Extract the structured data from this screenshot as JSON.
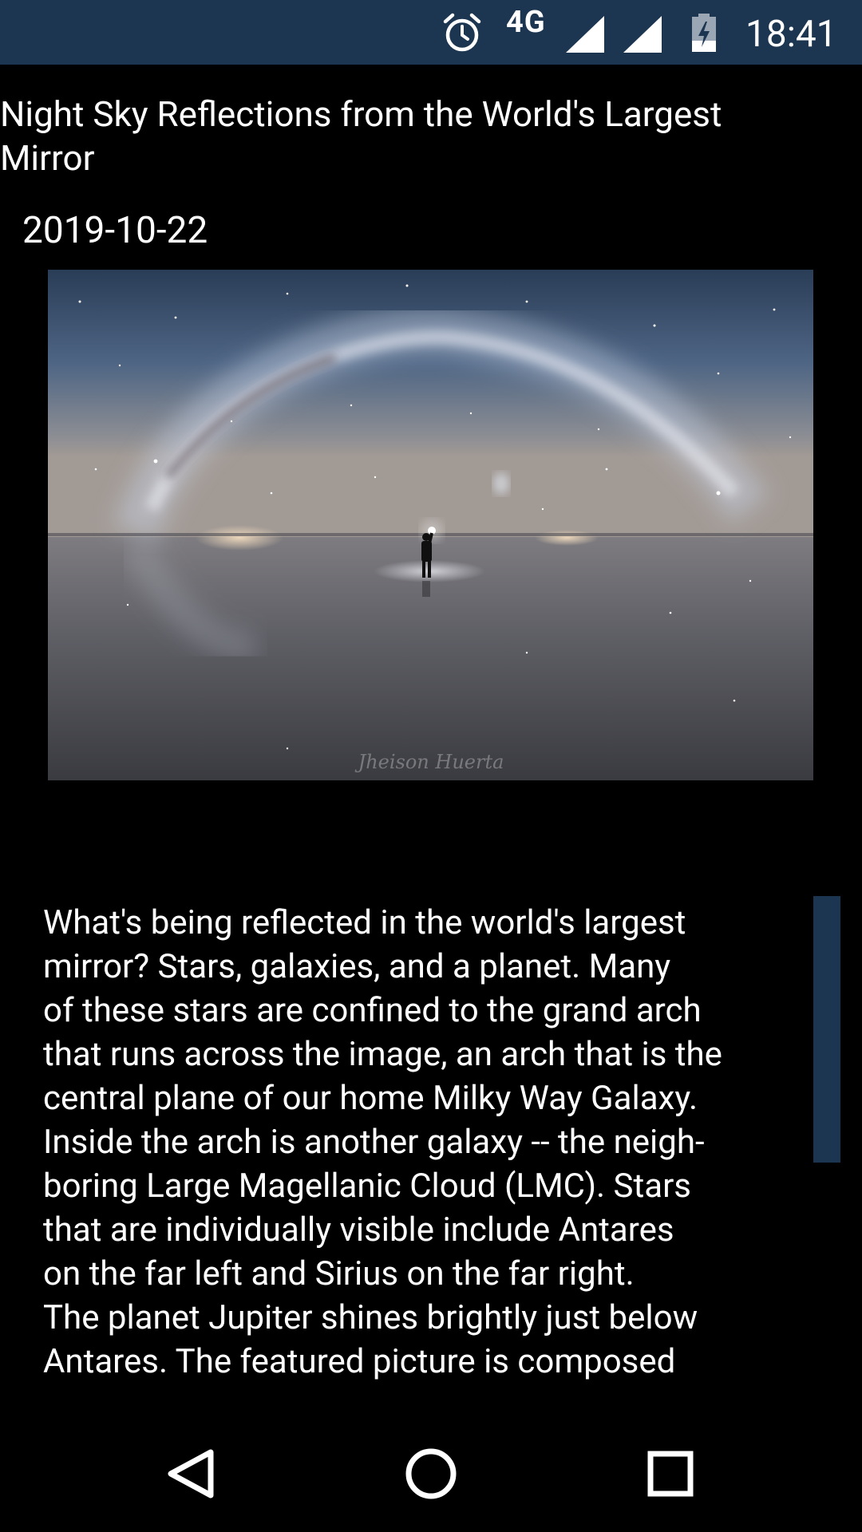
{
  "status_bar": {
    "network": "4G",
    "time": "18:41",
    "icons": [
      "alarm-icon",
      "signal-icon",
      "signal-icon",
      "battery-charging-icon"
    ]
  },
  "article": {
    "title": "Night Sky Reflections from the World's Largest Mirror",
    "date": "2019-10-22",
    "image": {
      "subject": "Milky Way arch reflected over salt flat with lone figure",
      "signature": "Jheison Huerta"
    },
    "body": "What's being reflected in the world's largest\nmirror?  Stars, galaxies, and a planet.  Many\nof these stars are confined to the grand arch\nthat runs across the image, an arch that is the\ncentral plane of our home Milky Way Galaxy.\nInside the arch is another galaxy -- the neigh-\nboring Large Magellanic Cloud (LMC).  Stars\nthat are individually visible include Antares\non the far left and Sirius on the far right.\nThe planet Jupiter shines brightly just below\nAntares. The featured picture is composed"
  },
  "nav_bar": {
    "icons": [
      "back-icon",
      "home-icon",
      "recent-apps-icon"
    ]
  },
  "colors": {
    "status_bar": "#1c3551",
    "scroll_thumb": "#1c3551",
    "background": "#000000",
    "text": "#ffffff"
  }
}
